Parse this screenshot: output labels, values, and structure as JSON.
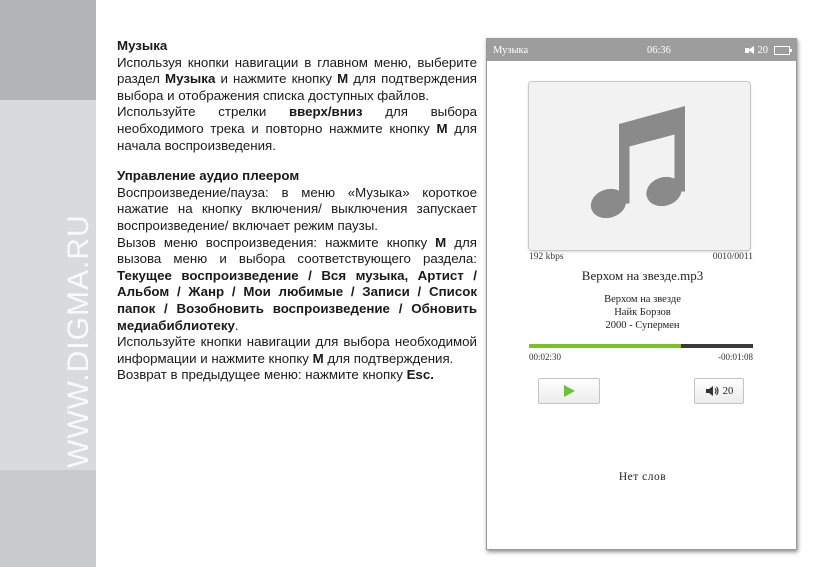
{
  "side_strip": {
    "site": "WWW.DIGMA.RU"
  },
  "manual": {
    "section1": {
      "heading": "Музыка",
      "para1": [
        {
          "t": "Используя кнопки навигации в главном меню, выберите раздел "
        },
        {
          "t": "Музыка",
          "b": true
        },
        {
          "t": " и нажмите кнопку "
        },
        {
          "t": "M",
          "b": true
        },
        {
          "t": " для подтверждения выбора и отображения списка доступных файлов."
        }
      ],
      "para2": [
        {
          "t": "Используйте стрелки "
        },
        {
          "t": "вверх/вниз",
          "b": true
        },
        {
          "t": " для выбора необходимого трека и повторно нажмите кнопку "
        },
        {
          "t": "M",
          "b": true
        },
        {
          "t": " для начала воспроизведения."
        }
      ]
    },
    "section2": {
      "heading": "Управление аудио плеером",
      "para1": [
        {
          "t": "Воспроизведение/пауза: в меню «Музыка» короткое нажатие на кнопку включения/ выключения запускает воспроизведение/ включает режим паузы."
        }
      ],
      "para2": [
        {
          "t": "Вызов меню воспроизведения: нажмите кнопку "
        },
        {
          "t": "M",
          "b": true
        },
        {
          "t": " для вызова меню и выбора соответствующего раздела: "
        },
        {
          "t": "Текущее воспроизведение / Вся музыка, Артист / Альбом / Жанр / Мои любимые / Записи / Список папок / Возобновить воспроизведение / Обновить медиабиблиотеку",
          "b": true
        },
        {
          "t": "."
        }
      ],
      "para3": [
        {
          "t": "Используйте кнопки навигации для выбора необходимой информации и нажмите кнопку "
        },
        {
          "t": "M",
          "b": true
        },
        {
          "t": " для подтверждения."
        }
      ],
      "para4": [
        {
          "t": "Возврат в предыдущее меню: нажмите кнопку "
        },
        {
          "t": "Esc.",
          "b": true
        }
      ]
    }
  },
  "device": {
    "status": {
      "title": "Музыка",
      "time": "06:36",
      "volume": "20"
    },
    "cover_icon": "music-note-icon",
    "bitrate": "192 kbps",
    "track_counter": "0010/0011",
    "filename": "Верхом на звезде.mp3",
    "song_title": "Верхом на звезде",
    "artist": "Найк Борзов",
    "album": "2000 - Супермен",
    "elapsed": "00:02:30",
    "remaining": "-00:01:08",
    "progress_fraction": 0.68,
    "play_icon": "play-icon",
    "volume_icon": "speaker-icon",
    "volume_level": "20",
    "lyrics": "Нет слов",
    "colors": {
      "progress_fill": "#7fbf2e",
      "progress_track": "#3a3a3a",
      "play": "#6cc23a",
      "statusbar": "#9d9d9d",
      "note": "#8a8a8a"
    }
  }
}
